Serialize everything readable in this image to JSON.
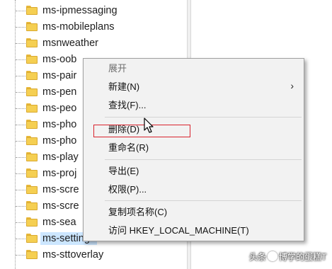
{
  "tree": {
    "items": [
      {
        "label": "ms-ipmessaging"
      },
      {
        "label": "ms-mobileplans"
      },
      {
        "label": "msnweather"
      },
      {
        "label": "ms-oob"
      },
      {
        "label": "ms-pair"
      },
      {
        "label": "ms-pen"
      },
      {
        "label": "ms-peo"
      },
      {
        "label": "ms-pho"
      },
      {
        "label": "ms-pho"
      },
      {
        "label": "ms-play"
      },
      {
        "label": "ms-proj"
      },
      {
        "label": "ms-scre"
      },
      {
        "label": "ms-scre"
      },
      {
        "label": "ms-sea"
      },
      {
        "label": "ms-settings",
        "selected": true
      },
      {
        "label": "ms-sttoverlay"
      }
    ]
  },
  "context_menu": {
    "items": [
      {
        "label": "展开",
        "disabled": true
      },
      {
        "label": "新建(N)",
        "submenu": true
      },
      {
        "label": "查找(F)..."
      },
      {
        "label": "删除(D)",
        "highlighted": true
      },
      {
        "label": "重命名(R)"
      },
      {
        "label": "导出(E)"
      },
      {
        "label": "权限(P)..."
      },
      {
        "label": "复制项名称(C)"
      },
      {
        "label": "访问 HKEY_LOCAL_MACHINE(T)"
      }
    ],
    "submenu_arrow": "›"
  },
  "annotation": {
    "color": "#d9232d"
  },
  "watermark": {
    "text_prefix": "头条",
    "text_suffix": "博学的蛋糕T"
  },
  "icons": {
    "tree_item": "folder-icon",
    "pointer": "mouse-cursor-icon"
  }
}
